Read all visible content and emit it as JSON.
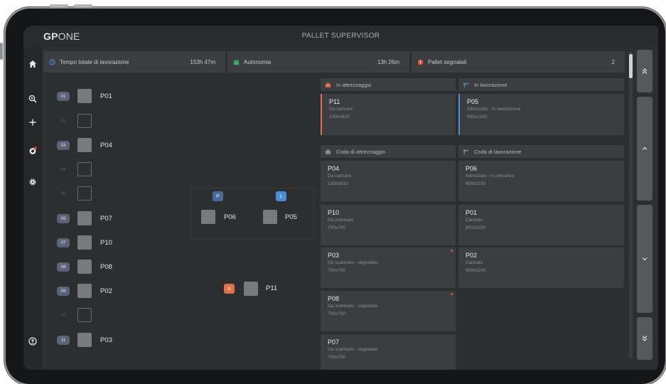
{
  "app": {
    "logo_gp": "GP",
    "logo_one": "ONE",
    "title": "PALLET SUPERVISOR"
  },
  "sidebar": {
    "items": [
      {
        "icon": "home-icon"
      },
      {
        "icon": "search-settings-icon"
      },
      {
        "icon": "plus-icon"
      },
      {
        "icon": "alert-icon"
      },
      {
        "icon": "gear-icon"
      },
      {
        "icon": "user-icon"
      }
    ]
  },
  "stats": [
    {
      "label": "Tempo totale di lavorazione",
      "value": "153h 47m",
      "icon": "clock-icon",
      "icon_color": "#4a90d9"
    },
    {
      "label": "Autonomia",
      "value": "13h 26m",
      "icon": "calendar-icon",
      "icon_color": "#3bb273"
    },
    {
      "label": "Pallet segnalati",
      "value": "2",
      "icon": "warning-icon",
      "icon_color": "#e0533b"
    }
  ],
  "lanes": [
    {
      "num": "01",
      "label": "P01",
      "filled": true
    },
    {
      "num": "02",
      "label": "",
      "filled": false
    },
    {
      "num": "03",
      "label": "P04",
      "filled": true
    },
    {
      "num": "04",
      "label": "",
      "filled": false
    },
    {
      "num": "05",
      "label": "",
      "filled": false
    },
    {
      "num": "06",
      "label": "P07",
      "filled": true
    },
    {
      "num": "07",
      "label": "P10",
      "filled": true
    },
    {
      "num": "08",
      "label": "P08",
      "filled": true
    },
    {
      "num": "09",
      "label": "P02",
      "filled": true
    },
    {
      "num": "10",
      "label": "",
      "filled": false
    },
    {
      "num": "11",
      "label": "P03",
      "filled": true
    }
  ],
  "stations": {
    "p_badge": "P",
    "l_badge": "L",
    "a_badge": "A",
    "p_pallet": "P06",
    "l_pallet": "P05",
    "a_pallet": "P11",
    "colors": {
      "p": "#4a6a98",
      "l": "#4a8fd6",
      "a": "#e0714b"
    }
  },
  "columns": {
    "in_attrezzaggio": {
      "title": "In attrezzaggio",
      "icon": "toolbox-icon",
      "icon_color": "#e0714b"
    },
    "in_lavorazione": {
      "title": "In lavorazione",
      "icon": "drill-icon",
      "icon_color": "#4a90d9"
    },
    "coda_attrezzaggio": {
      "title": "Coda di attrezzaggio",
      "icon": "toolbox-icon",
      "icon_color": "#8c8e92"
    },
    "coda_lavorazione": {
      "title": "Coda di lavorazione",
      "icon": "drill-icon",
      "icon_color": "#8c8e92"
    }
  },
  "cards": {
    "active_setup": {
      "code": "P11",
      "status": "Da caricare",
      "dims": "1350x810",
      "accent": "#e0714b"
    },
    "active_work": {
      "code": "P05",
      "status": "Attrezzato - In lavorazione",
      "dims": "900x1100",
      "accent": "#4a90d9"
    },
    "setup_queue": [
      {
        "code": "P04",
        "status": "Da caricare",
        "dims": "1350x810",
        "flag": false
      },
      {
        "code": "P10",
        "status": "Da scaricare",
        "dims": "700x700",
        "flag": false
      },
      {
        "code": "P03",
        "status": "Da scaricare - segnalato",
        "dims": "700x700",
        "flag": true
      },
      {
        "code": "P08",
        "status": "Da scaricare - segnalato",
        "dims": "700x700",
        "flag": true
      },
      {
        "code": "P07",
        "status": "Da scaricare - segnalato",
        "dims": "700x700",
        "flag": false
      }
    ],
    "work_queue": [
      {
        "code": "P06",
        "status": "Attrezzato - in precarico",
        "dims": "900x1100"
      },
      {
        "code": "P01",
        "status": "Caricato",
        "dims": "900x1100"
      },
      {
        "code": "P02",
        "status": "Caricato",
        "dims": "900x1100"
      }
    ]
  },
  "nav": {
    "buttons": [
      "scroll-top-icon",
      "scroll-up-icon",
      "scroll-down-icon",
      "scroll-bottom-icon"
    ]
  }
}
